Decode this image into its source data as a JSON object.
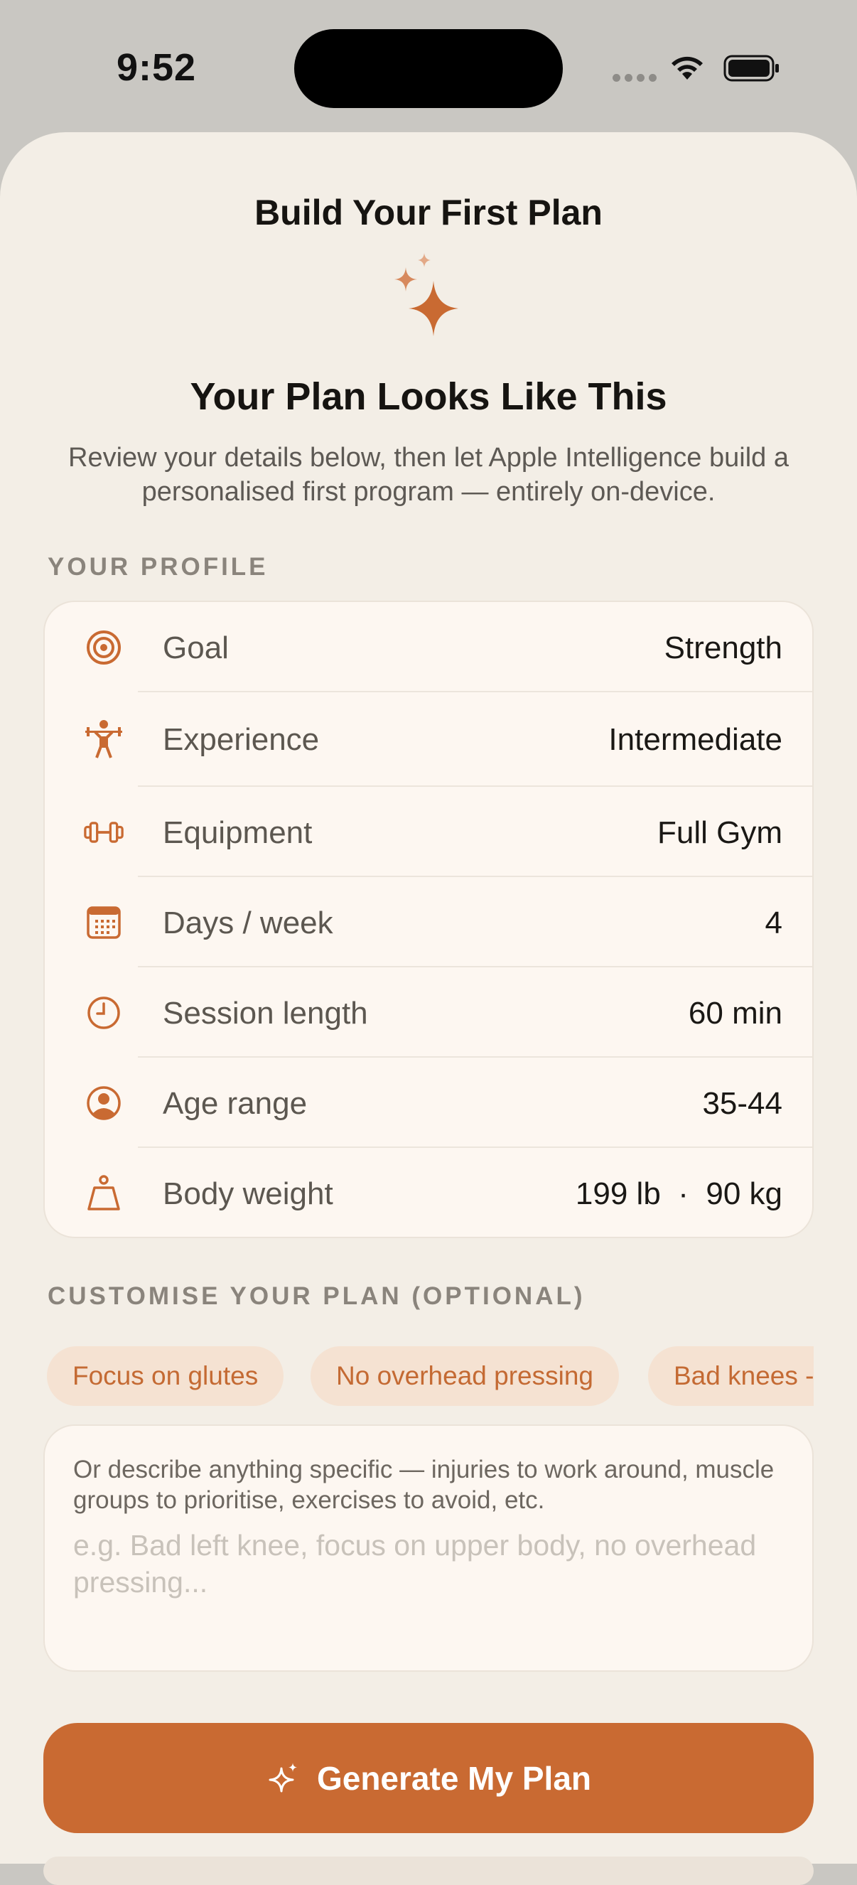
{
  "status_bar": {
    "time": "9:52"
  },
  "nav": {
    "title": "Build Your First Plan"
  },
  "hero": {
    "icon": "sparkles-icon",
    "title": "Your Plan Looks Like This",
    "subtitle": "Review your details below, then let Apple Intelligence build a personalised first program — entirely on-device."
  },
  "profile": {
    "header": "YOUR PROFILE",
    "rows": [
      {
        "icon": "target-icon",
        "label": "Goal",
        "value": "Strength"
      },
      {
        "icon": "weightlifter-icon",
        "label": "Experience",
        "value": "Intermediate"
      },
      {
        "icon": "dumbbell-icon",
        "label": "Equipment",
        "value": "Full Gym"
      },
      {
        "icon": "calendar-icon",
        "label": "Days / week",
        "value": "4"
      },
      {
        "icon": "clock-icon",
        "label": "Session length",
        "value": "60 min"
      },
      {
        "icon": "person-circle-icon",
        "label": "Age range",
        "value": "35-44"
      },
      {
        "icon": "scale-weight-icon",
        "label": "Body weight",
        "value": "199 lb  ·  90 kg"
      }
    ]
  },
  "customise": {
    "header": "CUSTOMISE YOUR PLAN (OPTIONAL)",
    "chips": [
      "Focus on glutes",
      "No overhead pressing",
      "Bad knees - low impact"
    ],
    "hint": "Or describe anything specific — injuries to work around, muscle groups to prioritise, exercises to avoid, etc.",
    "placeholder": "e.g. Bad left knee, focus on upper body, no overhead pressing...",
    "value": ""
  },
  "generate_button": {
    "label": "Generate My Plan",
    "icon": "sparkles-icon"
  },
  "colors": {
    "accent": "#C96A32",
    "background": "#F3EEE6",
    "card": "#FDF7F1",
    "chip_bg": "#F5E2D2"
  }
}
